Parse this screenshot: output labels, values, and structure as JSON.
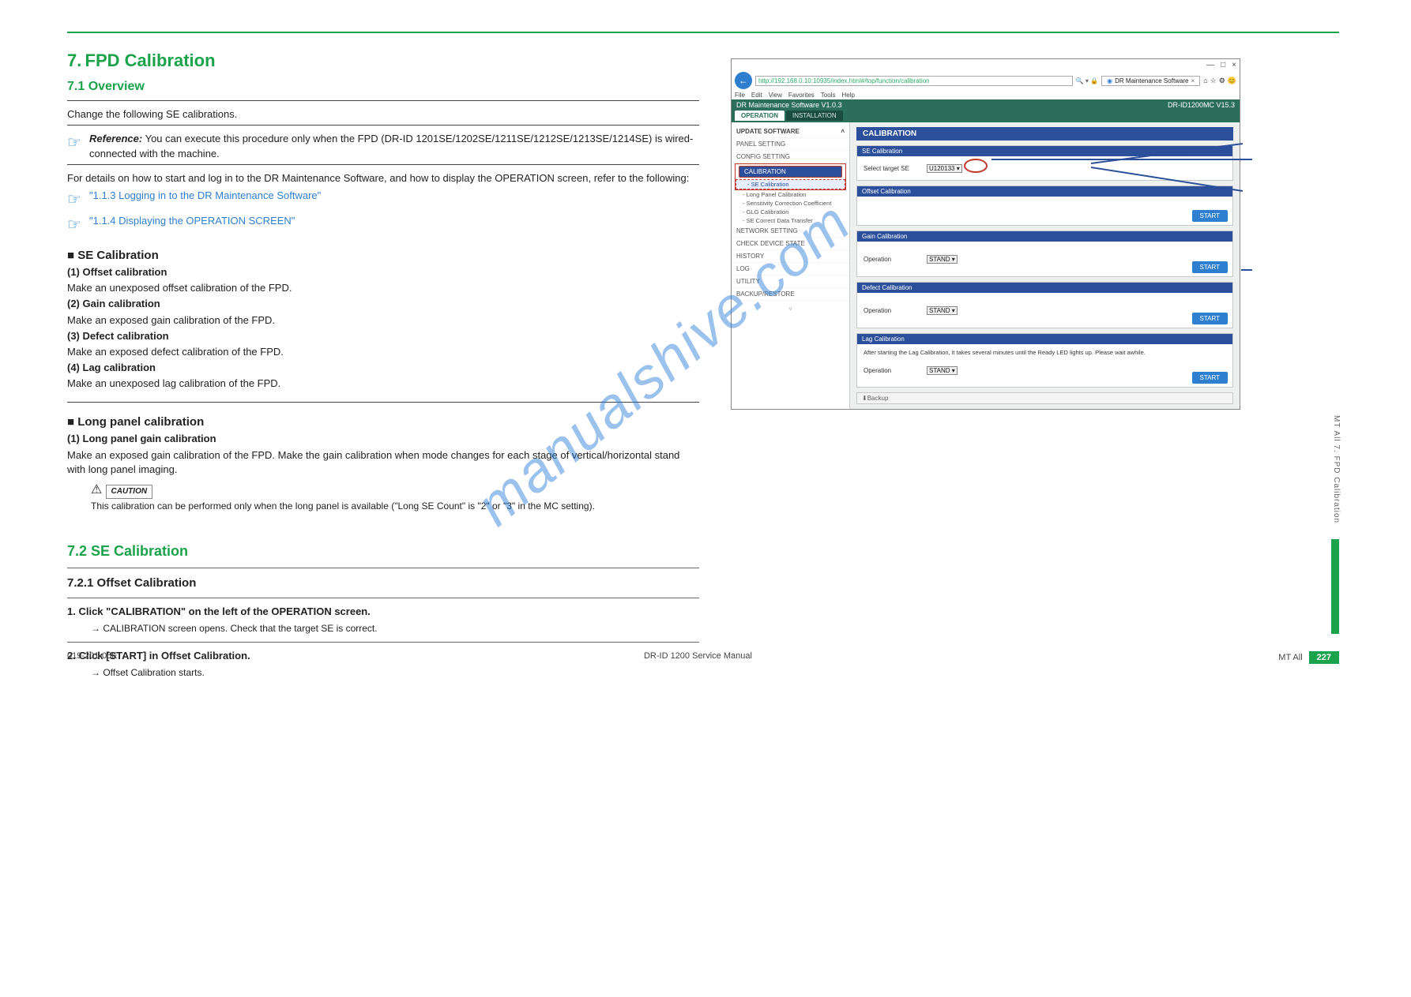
{
  "header_rule": true,
  "left": {
    "section_no": "7.",
    "section_title": "FPD Calibration",
    "section_sub": "7.1 Overview",
    "intro": "Change the following SE calibrations.",
    "ref1_label": "Reference:",
    "ref1_text": "You can execute this procedure only when the FPD (DR-ID 1201SE/1202SE/1211SE/1212SE/1213SE/1214SE) is wired-connected with the machine.",
    "ref2a_text": "\"1.1.3 Logging in to the DR Maintenance Software\"",
    "ref2b_text": "\"1.1.4 Displaying the OPERATION SCREEN\"",
    "block1": {
      "head": "■ SE Calibration",
      "items": [
        {
          "cap": "(1) Offset calibration",
          "body": "Make an unexposed offset calibration of the FPD."
        },
        {
          "cap": "(2) Gain calibration",
          "body": "Make an exposed gain calibration of the FPD."
        },
        {
          "cap": "(3) Defect calibration",
          "body": "Make an exposed defect calibration of the FPD."
        },
        {
          "cap": "(4) Lag calibration",
          "body": "Make an unexposed lag calibration of the FPD."
        }
      ]
    },
    "block2": {
      "head": "■ Long panel calibration",
      "cap": "(1) Long panel gain calibration",
      "body": "Make an exposed gain calibration of the FPD. Make the gain calibration when mode changes for each stage of vertical/horizontal stand with long panel imaging.",
      "caution_label": "CAUTION",
      "caution_body": "This calibration can be performed only when the long panel is available (\"Long SE Count\" is \"2\" or \"3\" in the MC setting)."
    },
    "sub72": "7.2 SE Calibration",
    "sub721": "7.2.1 Offset Calibration",
    "steps72": [
      {
        "n": "1.",
        "t": "Click \"CALIBRATION\" on the left of the OPERATION screen.",
        "arrow": "→ CALIBRATION screen opens. Check that the target SE is correct."
      },
      {
        "n": "2.",
        "t": "Click [START] in Offset Calibration.",
        "arrow": "→ Offset Calibration starts."
      }
    ]
  },
  "screenshot": {
    "win_buttons": [
      "—",
      "□",
      "×"
    ],
    "url": "http://192.168.0.10:10935/index.html#/top/function/calibration",
    "search_hint": "🔍 ▾ 🔒",
    "tab_title": "DR Maintenance Software",
    "fav": [
      "⌂",
      "☆",
      "⚙",
      "😊"
    ],
    "ie_menu": [
      "File",
      "Edit",
      "View",
      "Favorites",
      "Tools",
      "Help"
    ],
    "topbar_left": "DR Maintenance Software V1.0.3",
    "topbar_right": "DR-ID1200MC V15.3",
    "tabs": {
      "active": "OPERATION",
      "other": "INSTALLATION"
    },
    "sidebar": [
      "UPDATE SOFTWARE",
      "PANEL SETTING",
      "CONFIG SETTING",
      "CALIBRATION",
      "SE Calibration",
      "Long Panel Calibration",
      "Sensitivity Correction Coefficient",
      "GLG Calibration",
      "SE Correct Data Transfer",
      "NETWORK SETTING",
      "CHECK DEVICE STATE",
      "HISTORY",
      "LOG",
      "UTILITY",
      "BACKUP/RESTORE"
    ],
    "main_header": "CALIBRATION",
    "panels": {
      "se": {
        "title": "SE Calibration",
        "label": "Select target SE",
        "value": "U120133 ▾"
      },
      "offset": {
        "title": "Offset Calibration",
        "start": "START"
      },
      "gain": {
        "title": "Gain Calibration",
        "label": "Operation",
        "value": "STAND ▾",
        "start": "START"
      },
      "defect": {
        "title": "Defect Calibration",
        "label": "Operation",
        "value": "STAND ▾",
        "start": "START"
      },
      "lag": {
        "title": "Lag Calibration",
        "note": "After starting the Lag Calibration, it takes several minutes until the Ready LED lights up. Please wait awhile.",
        "label": "Operation",
        "value": "STAND ▾",
        "start": "START"
      }
    },
    "backup": "⬇Backup"
  },
  "footer": {
    "left": "019-201-05E",
    "center": "DR-ID 1200 Service Manual",
    "right_label": "MT All",
    "page_no": "227"
  },
  "side_label": "MT All 7. FPD Calibration",
  "watermark": "manualshive.com"
}
